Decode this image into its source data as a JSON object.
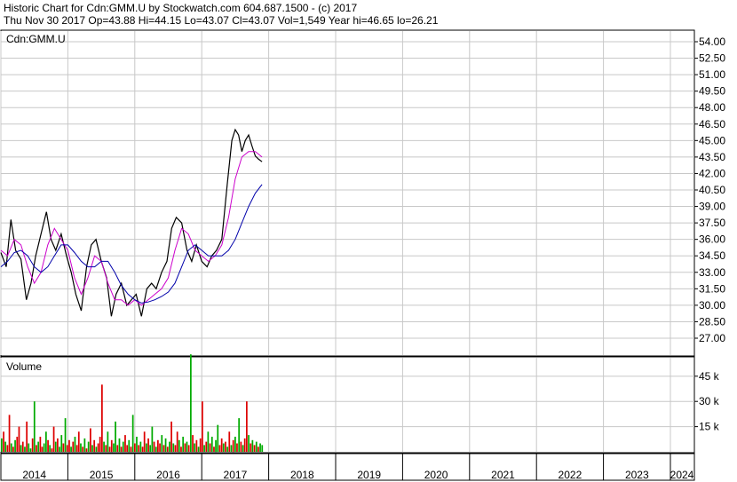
{
  "header": {
    "line1": "Historic Chart for Cdn:GMM.U by Stockwatch.com 604.687.1500 - (c) 2017",
    "line2": "Thu Nov 30 2017   Op=43.88   Hi=44.15   Lo=43.07   Cl=43.07   Vol=1,549   Year hi=46.65   lo=26.21"
  },
  "chart_data": [
    {
      "type": "line",
      "title": "Cdn:GMM.U",
      "ylim": [
        26.21,
        54.5
      ],
      "yticks": [
        "54.00",
        "52.50",
        "51.00",
        "49.50",
        "48.00",
        "46.50",
        "45.00",
        "43.50",
        "42.00",
        "40.50",
        "39.00",
        "37.50",
        "36.00",
        "34.50",
        "33.00",
        "31.50",
        "30.00",
        "28.50",
        "27.00"
      ],
      "xlim": [
        2014.0,
        2024.3
      ],
      "xticks": [
        "2014",
        "2015",
        "2016",
        "2017",
        "2018",
        "2019",
        "2020",
        "2021",
        "2022",
        "2023",
        "2024"
      ],
      "grid": true,
      "series": [
        {
          "role": "price",
          "color": "#000000",
          "x": [
            2014.0,
            2014.08,
            2014.15,
            2014.22,
            2014.3,
            2014.38,
            2014.45,
            2014.52,
            2014.6,
            2014.68,
            2014.75,
            2014.82,
            2014.9,
            2014.98,
            2015.05,
            2015.12,
            2015.2,
            2015.28,
            2015.35,
            2015.42,
            2015.5,
            2015.58,
            2015.65,
            2015.72,
            2015.8,
            2015.88,
            2015.95,
            2016.02,
            2016.1,
            2016.18,
            2016.25,
            2016.32,
            2016.4,
            2016.48,
            2016.55,
            2016.62,
            2016.7,
            2016.78,
            2016.85,
            2016.92,
            2017.0,
            2017.08,
            2017.15,
            2017.22,
            2017.3,
            2017.38,
            2017.45,
            2017.5,
            2017.55,
            2017.6,
            2017.65,
            2017.7,
            2017.75,
            2017.8,
            2017.85,
            2017.9
          ],
          "values": [
            34.8,
            33.5,
            37.8,
            35.0,
            34.2,
            30.5,
            32.0,
            34.5,
            36.5,
            38.5,
            36.0,
            35.0,
            36.5,
            34.5,
            33.0,
            31.0,
            29.5,
            33.5,
            35.5,
            36.0,
            34.0,
            32.5,
            29.0,
            31.0,
            32.0,
            30.0,
            30.5,
            31.0,
            29.0,
            31.5,
            32.0,
            31.5,
            33.0,
            34.0,
            37.0,
            38.0,
            37.5,
            35.0,
            34.0,
            35.5,
            34.0,
            33.5,
            34.5,
            35.0,
            36.0,
            41.0,
            45.0,
            46.0,
            45.5,
            44.0,
            45.0,
            45.5,
            44.5,
            43.6,
            43.3,
            43.07
          ]
        },
        {
          "role": "ma-short",
          "color": "#cc00cc",
          "x": [
            2014.0,
            2014.1,
            2014.2,
            2014.3,
            2014.4,
            2014.5,
            2014.6,
            2014.7,
            2014.8,
            2014.9,
            2015.0,
            2015.1,
            2015.2,
            2015.3,
            2015.4,
            2015.5,
            2015.6,
            2015.7,
            2015.8,
            2015.9,
            2016.0,
            2016.1,
            2016.2,
            2016.3,
            2016.4,
            2016.5,
            2016.6,
            2016.7,
            2016.8,
            2016.9,
            2017.0,
            2017.1,
            2017.2,
            2017.3,
            2017.4,
            2017.5,
            2017.6,
            2017.7,
            2017.8,
            2017.9
          ],
          "values": [
            35.0,
            34.5,
            36.0,
            35.5,
            33.5,
            32.0,
            33.0,
            35.5,
            37.0,
            36.0,
            35.0,
            32.5,
            31.0,
            32.5,
            34.5,
            34.0,
            32.0,
            30.5,
            30.5,
            30.0,
            30.5,
            30.0,
            30.5,
            31.0,
            31.5,
            32.5,
            35.0,
            37.0,
            36.5,
            35.0,
            34.5,
            34.0,
            34.5,
            35.5,
            38.0,
            41.5,
            43.5,
            44.0,
            44.0,
            43.5
          ]
        },
        {
          "role": "ma-long",
          "color": "#0000aa",
          "x": [
            2014.0,
            2014.1,
            2014.2,
            2014.3,
            2014.4,
            2014.5,
            2014.6,
            2014.7,
            2014.8,
            2014.9,
            2015.0,
            2015.1,
            2015.2,
            2015.3,
            2015.4,
            2015.5,
            2015.6,
            2015.7,
            2015.8,
            2015.9,
            2016.0,
            2016.1,
            2016.2,
            2016.3,
            2016.4,
            2016.5,
            2016.6,
            2016.7,
            2016.8,
            2016.9,
            2017.0,
            2017.1,
            2017.2,
            2017.3,
            2017.4,
            2017.5,
            2017.6,
            2017.7,
            2017.8,
            2017.9
          ],
          "values": [
            33.5,
            34.0,
            34.8,
            35.0,
            34.5,
            33.5,
            33.0,
            33.5,
            34.5,
            35.5,
            35.5,
            34.8,
            34.0,
            33.5,
            33.5,
            34.0,
            34.0,
            33.0,
            31.8,
            31.0,
            30.5,
            30.2,
            30.3,
            30.5,
            30.8,
            31.2,
            32.0,
            33.5,
            35.0,
            35.5,
            35.0,
            34.5,
            34.5,
            34.5,
            35.0,
            36.0,
            37.5,
            39.0,
            40.2,
            41.0
          ]
        }
      ]
    },
    {
      "type": "bar",
      "title": "Volume",
      "ylim": [
        0,
        56000
      ],
      "yticks": [
        "45 k",
        "30 k",
        "15 k"
      ],
      "colors": {
        "up": "#00aa00",
        "down": "#dd0000"
      },
      "x_start": 2014.0,
      "x_end": 2017.92,
      "values": [
        8000,
        12000,
        6000,
        4000,
        22000,
        5000,
        3000,
        7000,
        9000,
        15000,
        4000,
        6000,
        3000,
        18000,
        5000,
        2000,
        8000,
        30000,
        4000,
        6000,
        9000,
        3000,
        5000,
        12000,
        7000,
        4000,
        2000,
        15000,
        6000,
        8000,
        3000,
        10000,
        5000,
        20000,
        4000,
        7000,
        3000,
        6000,
        9000,
        4000,
        12000,
        5000,
        3000,
        8000,
        2000,
        6000,
        14000,
        4000,
        7000,
        3000,
        5000,
        9000,
        40000,
        6000,
        4000,
        12000,
        3000,
        7000,
        5000,
        18000,
        4000,
        8000,
        3000,
        6000,
        10000,
        4000,
        7000,
        3000,
        22000,
        5000,
        9000,
        4000,
        6000,
        3000,
        12000,
        5000,
        8000,
        4000,
        15000,
        6000,
        3000,
        7000,
        5000,
        10000,
        4000,
        8000,
        3000,
        6000,
        18000,
        5000,
        4000,
        12000,
        7000,
        3000,
        9000,
        5000,
        6000,
        4000,
        58000,
        10000,
        5000,
        7000,
        3000,
        8000,
        30000,
        4000,
        6000,
        12000,
        5000,
        9000,
        3000,
        7000,
        16000,
        4000,
        8000,
        5000,
        6000,
        3000,
        12000,
        4000,
        7000,
        9000,
        5000,
        20000,
        6000,
        4000,
        8000,
        30000,
        10000,
        5000,
        7000,
        4000,
        6000,
        3000,
        5000,
        4000
      ],
      "directions": [
        1,
        0,
        1,
        0,
        0,
        1,
        0,
        1,
        0,
        0,
        1,
        0,
        1,
        0,
        1,
        1,
        0,
        1,
        0,
        1,
        0,
        0,
        1,
        1,
        0,
        1,
        0,
        0,
        1,
        0,
        1,
        1,
        0,
        1,
        0,
        0,
        1,
        0,
        1,
        0,
        0,
        1,
        0,
        1,
        0,
        1,
        0,
        1,
        0,
        1,
        0,
        0,
        0,
        1,
        0,
        1,
        0,
        0,
        1,
        1,
        0,
        1,
        0,
        1,
        0,
        0,
        1,
        0,
        1,
        0,
        1,
        0,
        1,
        0,
        0,
        1,
        0,
        1,
        1,
        0,
        1,
        0,
        0,
        1,
        0,
        1,
        0,
        1,
        0,
        1,
        0,
        0,
        1,
        0,
        1,
        0,
        1,
        0,
        1,
        0,
        1,
        0,
        1,
        0,
        0,
        1,
        0,
        1,
        0,
        1,
        0,
        1,
        1,
        0,
        0,
        1,
        0,
        1,
        0,
        1,
        0,
        1,
        0,
        1,
        0,
        1,
        0,
        0,
        1,
        0,
        1,
        0,
        1,
        0,
        1,
        1
      ]
    }
  ]
}
